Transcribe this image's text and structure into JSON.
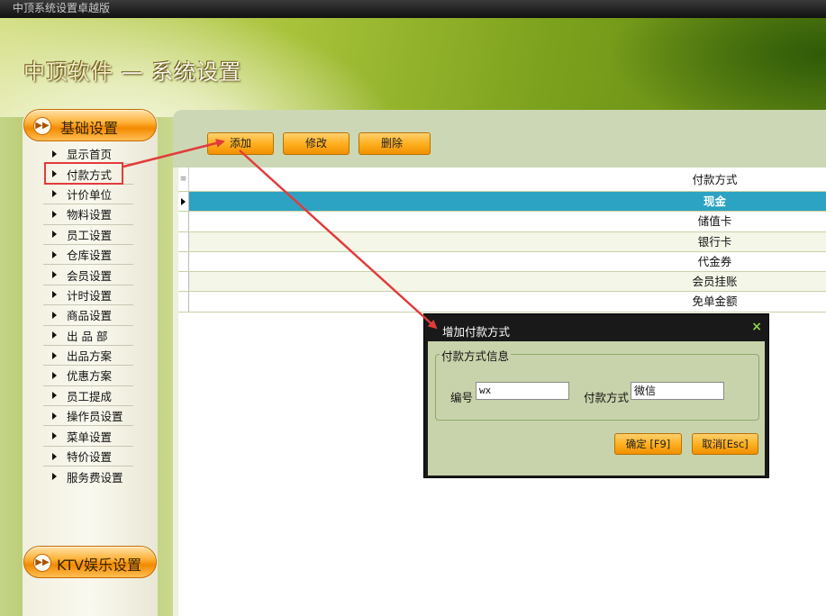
{
  "window": {
    "title": "中顶系统设置卓越版"
  },
  "header": {
    "brand": "中顶软件",
    "separator": "—",
    "subtitle": "系统设置"
  },
  "sidebar": {
    "section_label": "基础设置",
    "items": [
      {
        "label": "显示首页"
      },
      {
        "label": "付款方式"
      },
      {
        "label": "计价单位"
      },
      {
        "label": "物料设置"
      },
      {
        "label": "员工设置"
      },
      {
        "label": "仓库设置"
      },
      {
        "label": "会员设置"
      },
      {
        "label": "计时设置"
      },
      {
        "label": "商品设置"
      },
      {
        "label": "出 品 部"
      },
      {
        "label": "出品方案"
      },
      {
        "label": "优惠方案"
      },
      {
        "label": "员工提成"
      },
      {
        "label": "操作员设置"
      },
      {
        "label": "菜单设置"
      },
      {
        "label": "特价设置"
      },
      {
        "label": "服务费设置"
      }
    ],
    "bottom_section_label": "KTV娱乐设置"
  },
  "toolbar": {
    "add": "添加",
    "edit": "修改",
    "delete": "删除"
  },
  "grid": {
    "column": "付款方式",
    "rows": [
      "现金",
      "储值卡",
      "银行卡",
      "代金券",
      "会员挂账",
      "免单金额"
    ],
    "selected": "现金"
  },
  "dialog": {
    "title": "增加付款方式",
    "close_glyph": "×",
    "group_label": "付款方式信息",
    "code_label": "编号",
    "code_value": "wx",
    "name_label": "付款方式",
    "name_value": "微信",
    "confirm": "确定 [F9]",
    "cancel": "取消[Esc]"
  },
  "colors": {
    "selected_row": "#2ca3c2",
    "button": "#ffb020",
    "annotation": "#e23b3b"
  }
}
